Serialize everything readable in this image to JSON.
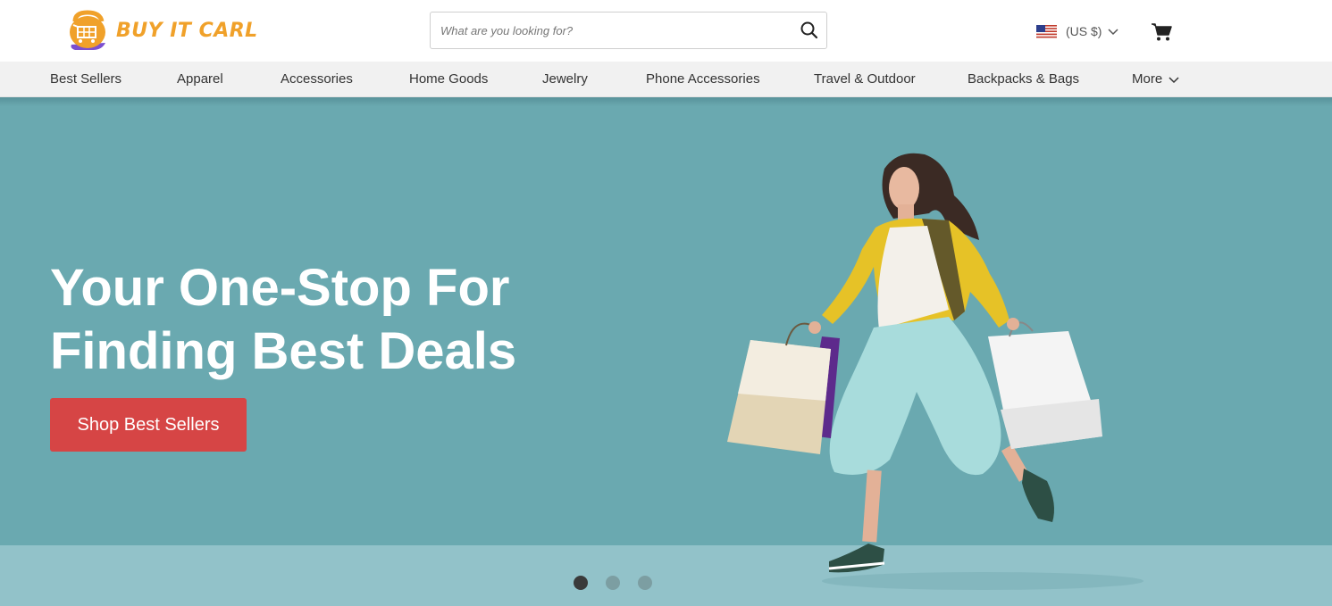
{
  "header": {
    "logo_text": "BUY IT CARL",
    "search": {
      "placeholder": "What are you looking for?",
      "value": ""
    },
    "currency": {
      "label": "(US $)",
      "flag": "us-flag-icon"
    },
    "cart_icon": "cart-icon"
  },
  "nav": {
    "items": [
      {
        "label": "Best Sellers"
      },
      {
        "label": "Apparel"
      },
      {
        "label": "Accessories"
      },
      {
        "label": "Home Goods"
      },
      {
        "label": "Jewelry"
      },
      {
        "label": "Phone Accessories"
      },
      {
        "label": "Travel & Outdoor"
      },
      {
        "label": "Backpacks & Bags"
      },
      {
        "label": "More"
      }
    ]
  },
  "hero": {
    "headline_line1": "Your One-Stop For",
    "headline_line2": "Finding Best Deals",
    "cta_label": "Shop Best Sellers",
    "slides": {
      "count": 3,
      "active": 1
    },
    "colors": {
      "background": "#6aa9b0",
      "floor": "#92c2c9",
      "cta": "#d64545"
    }
  },
  "colors": {
    "brand": "#f0a12a",
    "logo_accent": "#7b4fd0"
  }
}
